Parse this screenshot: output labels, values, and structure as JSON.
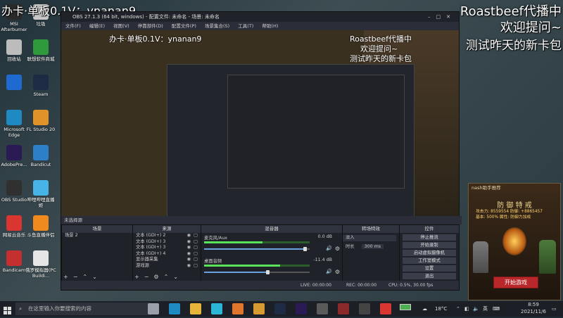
{
  "overlay": {
    "topleft": "办卡·单板0.1V：ynanan9",
    "topright1": "Roastbeef代播中",
    "topright2": "欢迎提问~",
    "topright3": "测试昨天的新卡包"
  },
  "desktop_icons": [
    {
      "label": "MSI Afterburner",
      "color": "#2a2a2a"
    },
    {
      "label": "垃圾",
      "color": "#c9c9c9"
    },
    {
      "label": "回收站",
      "color": "#bcbcbc"
    },
    {
      "label": "联想软件商城",
      "color": "#2f9a3c"
    },
    {
      "label": "",
      "color": "#1e6ad1"
    },
    {
      "label": "Steam",
      "color": "#1d2b45"
    },
    {
      "label": "Microsoft Edge",
      "color": "#1f8ac2"
    },
    {
      "label": "FL Studio 20",
      "color": "#e19228"
    },
    {
      "label": "AdobePre...",
      "color": "#2a1b54"
    },
    {
      "label": "Bandicut",
      "color": "#2d7fc8"
    },
    {
      "label": "OBS Studio",
      "color": "#303030"
    },
    {
      "label": "哔哩哔哩直播姬",
      "color": "#46b4e6"
    },
    {
      "label": "网易云音乐",
      "color": "#d93631"
    },
    {
      "label": "斗鱼直播伴侣",
      "color": "#f08a1f"
    },
    {
      "label": "Bandicam",
      "color": "#c42f2f"
    },
    {
      "label": "俄罗模拟器(PC Buildi...",
      "color": "#e6e6e6"
    }
  ],
  "obs": {
    "title": "OBS 27.1.3 (64 bit, windows) - 配置文件: 未命名 - 场景: 未命名",
    "menu": [
      "文件(F)",
      "编辑(E)",
      "视图(V)",
      "停靠部件(D)",
      "配置文件(P)",
      "场景集合(S)",
      "工具(T)",
      "帮助(H)"
    ],
    "scene_label": "未选择源",
    "preview_text_left": "办卡·单板0.1V：ynanan9",
    "preview_text_right1": "Roastbeef代播中",
    "preview_text_right2": "欢迎提问~",
    "preview_text_right3": "测试昨天的新卡包",
    "docks": {
      "scenes_header": "场景",
      "scenes": [
        "场景 2"
      ],
      "sources_header": "来源",
      "sources": [
        "文本 (GDI+) 2",
        "文本 (GDI+) 3",
        "文本 (GDI+) 3",
        "文本 (GDI+) 4",
        "显示器采集",
        "游戏源"
      ],
      "mixer_header": "混音器",
      "mixer": [
        {
          "name": "麦克风/Aux",
          "db": "0.0 dB",
          "level": 0.55,
          "volume": 0.95
        },
        {
          "name": "桌面音频",
          "db": "-11.4 dB",
          "level": 0.72,
          "volume": 0.6
        }
      ],
      "transitions_header": "转场特效",
      "transition_name": "淡入",
      "duration_label": "时长",
      "duration_value": "300 ms",
      "controls_header": "控件",
      "controls": [
        "停止推流",
        "开始录制",
        "启动虚拟摄像机",
        "工作室模式",
        "设置",
        "退出"
      ]
    },
    "status": {
      "live": "LIVE: 00:00:00",
      "rec": "REC: 00:00:00",
      "cpu": "CPU: 0.5%, 30.00 fps"
    }
  },
  "gamead": {
    "header": "nash助手推荐",
    "title": "防 御 特 戒",
    "stats": [
      "攻击力: 8559554   防御: +8865457",
      "基本: 500%   属性: 防御力加成"
    ],
    "button": "开始游戏"
  },
  "taskbar": {
    "search_placeholder": "在这里输入你要搜索的内容",
    "temperature": "18°C",
    "ime": "英",
    "time": "8:59",
    "date": "2021/11/6"
  }
}
